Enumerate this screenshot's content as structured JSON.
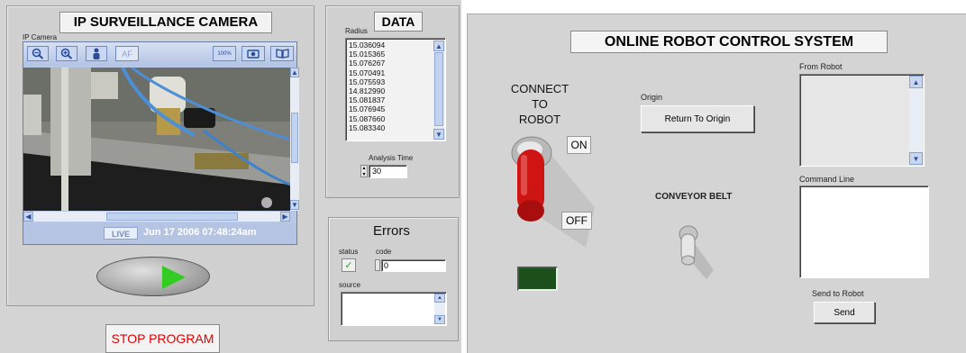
{
  "camera": {
    "title": "IP SURVEILLANCE CAMERA",
    "label": "IP Camera",
    "toolbar_left": [
      {
        "icon": "zoom-out-icon",
        "glyph": "−"
      },
      {
        "icon": "zoom-in-icon",
        "glyph": "+"
      },
      {
        "icon": "person-icon",
        "glyph": "●"
      }
    ],
    "toolbar_af": "AF",
    "toolbar_right": [
      {
        "icon": "fit-100-icon",
        "glyph": "100%"
      },
      {
        "icon": "snapshot-icon",
        "glyph": "◙"
      },
      {
        "icon": "book-icon",
        "glyph": "▤"
      }
    ],
    "live": "LIVE",
    "timestamp": "Jun 17 2006 07:48:24am"
  },
  "data_panel": {
    "title": "DATA",
    "radius_label": "Radius",
    "radius_values": [
      "15.036094",
      "15.015365",
      "15.076267",
      "15.070491",
      "15.075593",
      "14.812990",
      "15.081837",
      "15.076945",
      "15.087660",
      "15.083340"
    ],
    "analysis_label": "Analysis Time",
    "analysis_value": "30"
  },
  "errors": {
    "title": "Errors",
    "status_label": "status",
    "code_label": "code",
    "code_value": "0",
    "source_label": "source",
    "status_glyph": "✓"
  },
  "stop_label": "STOP PROGRAM",
  "robot": {
    "title": "ONLINE ROBOT CONTROL SYSTEM",
    "connect_lines": [
      "CONNECT",
      "TO",
      "ROBOT"
    ],
    "on_label": "ON",
    "off_label": "OFF",
    "origin_label": "Origin",
    "return_button": "Return To Origin",
    "conveyor_label": "CONVEYOR BELT",
    "from_robot_label": "From Robot",
    "command_line_label": "Command Line",
    "send_to_robot_label": "Send to Robot",
    "send_button": "Send"
  },
  "colors": {
    "panel": "#d4d4d4",
    "go_arrow": "#33cc22",
    "toggle_red": "#d41818",
    "led_off": "#1d4f1d",
    "stop_text": "#e00000"
  }
}
